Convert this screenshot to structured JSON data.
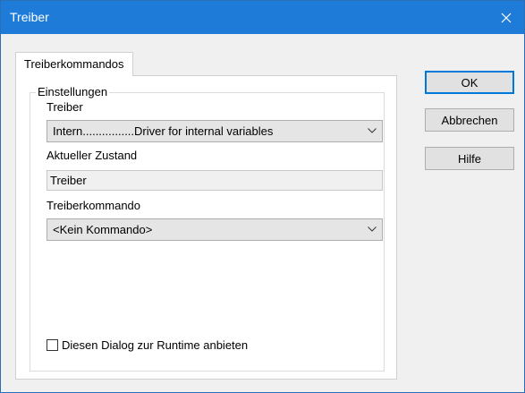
{
  "window": {
    "title": "Treiber"
  },
  "tabs": [
    {
      "label": "Treiberkommandos",
      "selected": true
    }
  ],
  "settings_group": {
    "legend": "Einstellungen",
    "driver": {
      "label": "Treiber",
      "selected": "Intern................Driver for internal variables"
    },
    "current_state": {
      "label": "Aktueller Zustand",
      "value": "Treiber"
    },
    "driver_command": {
      "label": "Treiberkommando",
      "selected": "<Kein Kommando>"
    },
    "runtime_checkbox": {
      "label": "Diesen Dialog zur Runtime anbieten",
      "checked": false
    }
  },
  "buttons": {
    "ok": "OK",
    "cancel": "Abbrechen",
    "help": "Hilfe"
  },
  "colors": {
    "titlebar": "#1f7bd8",
    "default_button_border": "#0078d7"
  }
}
